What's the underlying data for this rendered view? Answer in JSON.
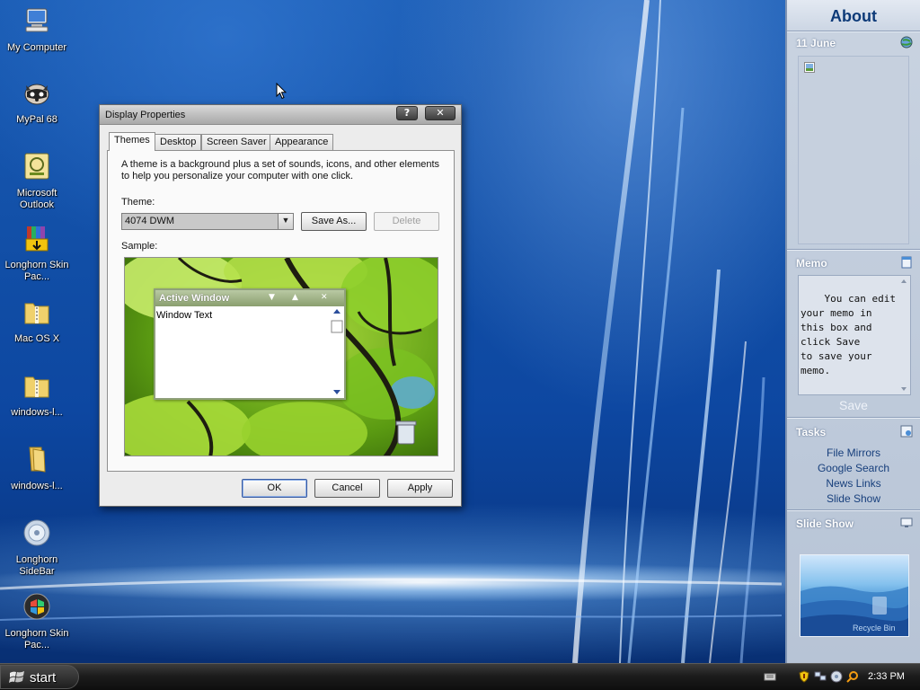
{
  "desktop": {
    "icons": [
      {
        "label": "My Computer",
        "icon": "my-computer-icon"
      },
      {
        "label": "MyPal 68",
        "icon": "raccoon-app-icon"
      },
      {
        "label": "Microsoft Outlook",
        "icon": "outlook-icon"
      },
      {
        "label": "Longhorn Skin Pac...",
        "icon": "installer-box-icon"
      },
      {
        "label": "Mac OS X",
        "icon": "zip-folder-icon"
      },
      {
        "label": "windows-l...",
        "icon": "zip-folder-icon"
      },
      {
        "label": "windows-l...",
        "icon": "folder-icon"
      },
      {
        "label": "Longhorn SideBar",
        "icon": "sidebar-app-icon"
      },
      {
        "label": "Longhorn Skin Pac...",
        "icon": "skin-pack-icon"
      }
    ]
  },
  "dialog": {
    "title": "Display Properties",
    "help_label": "?",
    "close_label": "✕",
    "tabs": [
      {
        "label": "Themes",
        "active": true
      },
      {
        "label": "Desktop",
        "active": false
      },
      {
        "label": "Screen Saver",
        "active": false
      },
      {
        "label": "Appearance",
        "active": false
      }
    ],
    "description": "A theme is a background plus a set of sounds, icons, and other elements to help you personalize your computer with one click.",
    "theme_label": "Theme:",
    "theme_value": "4074 DWM",
    "save_as_label": "Save As...",
    "delete_label": "Delete",
    "sample_label": "Sample:",
    "sample": {
      "window_title": "Active Window",
      "window_text": "Window Text"
    },
    "ok_label": "OK",
    "cancel_label": "Cancel",
    "apply_label": "Apply"
  },
  "sidebar": {
    "about_title": "About",
    "date": "11 June",
    "memo": {
      "title": "Memo",
      "text": "You can edit\nyour memo in\nthis box and\nclick Save\nto save your\nmemo.",
      "save_label": "Save"
    },
    "tasks": {
      "title": "Tasks",
      "items": [
        "File Mirrors",
        "Google Search",
        "News Links",
        "Slide Show"
      ]
    },
    "slideshow": {
      "title": "Slide Show",
      "caption": "Recycle Bin"
    }
  },
  "taskbar": {
    "start_label": "start",
    "clock": "2:33 PM"
  },
  "colors": {
    "wallpaper": "#0d47a1",
    "sidebar": "#c9d3e1",
    "sidebar_title": "#0d3a78",
    "taskbar": "#1c1c1c"
  }
}
